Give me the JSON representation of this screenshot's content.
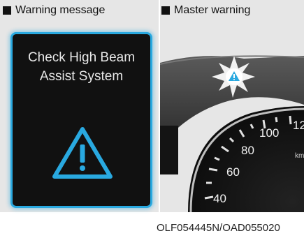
{
  "left_panel": {
    "caption": "Warning message",
    "message_line1": "Check High Beam",
    "message_line2": "Assist System"
  },
  "right_panel": {
    "caption": "Master warning",
    "speedo_labels": [
      "40",
      "60",
      "80",
      "100",
      "12"
    ],
    "unit_partial": "km"
  },
  "figure_code": "OLF054445N/OAD055020",
  "colors": {
    "accent": "#29a9e0",
    "display_bg": "#111111",
    "panel_bg": "#e6e6e6"
  }
}
